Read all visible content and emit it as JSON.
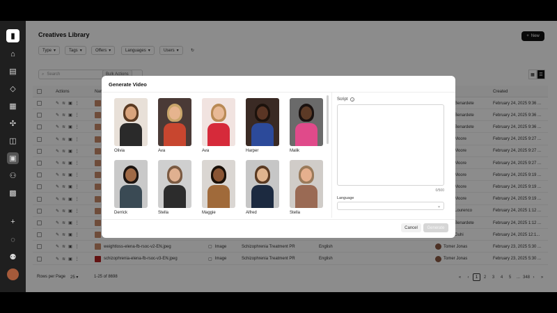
{
  "app": {
    "logo": "▮",
    "page_title": "Creatives Library",
    "new_button": "New"
  },
  "sidebar": {
    "icons": [
      "home-icon",
      "library-icon",
      "tag-icon",
      "grid-icon",
      "network-icon",
      "layers-icon",
      "chat-icon",
      "org-icon",
      "apps-icon",
      "plus-icon",
      "bell-icon",
      "users-icon"
    ]
  },
  "filters": [
    "Type",
    "Tags",
    "Offers",
    "Languages",
    "Users"
  ],
  "search": {
    "placeholder": "Search"
  },
  "bulk_label": "Bulk Actions",
  "table": {
    "headers": {
      "actions": "Actions",
      "name": "Nam",
      "created": "Created"
    },
    "rows": [
      {
        "owner": "Benardete",
        "created": "February 24, 2025 9:36 ..."
      },
      {
        "owner": "Benardete",
        "created": "February 24, 2025 9:36 ..."
      },
      {
        "owner": "Benardete",
        "created": "February 24, 2025 9:36 ..."
      },
      {
        "owner": "Moore",
        "created": "February 24, 2025 9:27 ..."
      },
      {
        "owner": "Moore",
        "created": "February 24, 2025 9:27 ..."
      },
      {
        "owner": "Moore",
        "created": "February 24, 2025 9:27 ..."
      },
      {
        "owner": "Moore",
        "created": "February 24, 2025 9:19 ..."
      },
      {
        "owner": "Moore",
        "created": "February 24, 2025 9:19 ..."
      },
      {
        "owner": "Moore",
        "created": "February 24, 2025 9:19 ..."
      },
      {
        "owner": "Lourenco",
        "created": "February 24, 2025 1:12 ..."
      },
      {
        "owner": "Benardete",
        "created": "February 24, 2025 1:12 ..."
      },
      {
        "owner": "Guhi",
        "created": "February 24, 2025 12:1..."
      },
      {
        "name": "weightloss-elena-fb-rsoc-v2-EN.jpeg",
        "type": "Image",
        "offer": "Schizophrenia Treatment PR",
        "language": "English",
        "owner": "Tomer Jonas",
        "created": "February 23, 2025 5:30 ..."
      },
      {
        "name": "schizophrenia-elena-fb-rsoc-v3-EN.jpeg",
        "type": "Image",
        "offer": "Schizophrenia Treatment PR",
        "language": "English",
        "owner": "Tomer Jonas",
        "created": "February 23, 2025 5:30 ..."
      }
    ]
  },
  "footer": {
    "rows_per_page_label": "Rows per Page",
    "rows_per_page": "25",
    "range": "1-25 of 8698",
    "pages": [
      "1",
      "2",
      "3",
      "4",
      "5",
      "...",
      "348"
    ]
  },
  "modal": {
    "title": "Generate Video",
    "avatars": [
      {
        "name": "Olivia",
        "bg": "#e8e0d8",
        "skin": "#d9a47d",
        "hair": "#5a3a22",
        "shirt": "#2a2a2a"
      },
      {
        "name": "Ava",
        "bg": "#4a3a36",
        "skin": "#e6b48e",
        "hair": "#c9a66b",
        "shirt": "#c8462f"
      },
      {
        "name": "Ava",
        "bg": "#f1e3e0",
        "skin": "#e8b996",
        "hair": "#b98a55",
        "shirt": "#d62a3a"
      },
      {
        "name": "Harper",
        "bg": "#3a2a24",
        "skin": "#5a3524",
        "hair": "#1c120c",
        "shirt": "#2c4a9a"
      },
      {
        "name": "Malik",
        "bg": "#6a6a6a",
        "skin": "#5c3a26",
        "hair": "#1a1210",
        "shirt": "#e04a8a"
      },
      {
        "name": "Derrick",
        "bg": "#c9c9c9",
        "skin": "#a06a46",
        "hair": "#1c1410",
        "shirt": "#3a4a54"
      },
      {
        "name": "Stella",
        "bg": "#cfcfcf",
        "skin": "#e0b090",
        "hair": "#7a5a42",
        "shirt": "#2c2c2c"
      },
      {
        "name": "Maggie",
        "bg": "#dad6d2",
        "skin": "#8a5534",
        "hair": "#1a1008",
        "shirt": "#a06a3a"
      },
      {
        "name": "Alfred",
        "bg": "#c6c6c6",
        "skin": "#e0b48e",
        "hair": "#5a3a22",
        "shirt": "#1c2a40"
      },
      {
        "name": "Stella",
        "bg": "#d0ccc8",
        "skin": "#e6b08e",
        "hair": "#9a7a5a",
        "shirt": "#9a6a54"
      }
    ],
    "script_label": "Script",
    "script_counter": "0/500",
    "language_label": "Language",
    "cancel_label": "Cancel",
    "generate_label": "Generate"
  }
}
